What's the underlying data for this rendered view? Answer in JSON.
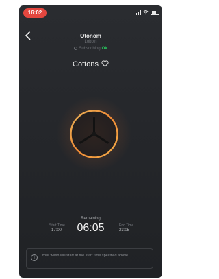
{
  "status_bar": {
    "time": "16:02"
  },
  "header": {
    "device_name": "Otonom",
    "device_sub": "Lobbin",
    "connection_text": "Subscribing",
    "connection_ok": "Ok",
    "program_name": "Cottons"
  },
  "timing": {
    "start_label": "Start Time",
    "start_value": "17:00",
    "remaining_label": "Remaining",
    "remaining_value": "06:05",
    "end_label": "End Time",
    "end_value": "23:05"
  },
  "info": {
    "text": "Your wash will start at the start time specified above."
  },
  "colors": {
    "accent": "#f0a14a",
    "status_pill": "#e4473f",
    "ok_green": "#27c25b",
    "background": "#26282c"
  },
  "icons": [
    "back-arrow-icon",
    "signal-icon",
    "wifi-icon",
    "battery-icon",
    "heart-icon",
    "fan-blade-icon",
    "info-icon"
  ]
}
